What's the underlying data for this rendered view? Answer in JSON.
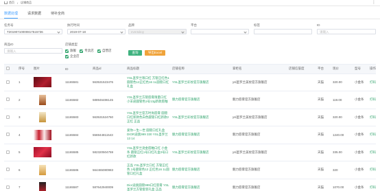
{
  "topbar": {
    "crumb1": "首页",
    "crumb2": "店铺商品",
    "right_icon": "more-icon"
  },
  "tabs": [
    {
      "label": "数据处理",
      "active": true
    },
    {
      "label": "请求数据",
      "active": false
    },
    {
      "label": "待补全商",
      "active": false
    }
  ],
  "filters": {
    "task_no": {
      "label": "任务号",
      "value": "T20190710000817515736"
    },
    "exec_time": {
      "label": "执行时间",
      "value": "2019-07-18"
    },
    "brand": {
      "label": "品牌",
      "value": "ever&boy"
    },
    "platform": {
      "label": "平台",
      "value": ""
    },
    "tag": {
      "label": "标签",
      "value": ""
    },
    "id": {
      "label": "ID",
      "placeholder": "请输入"
    },
    "product_id": {
      "label": "商品ID",
      "placeholder": "请输入"
    },
    "store_type": {
      "label": "店铺类型",
      "options": [
        "旗舰",
        "专卖店",
        "自营店",
        "企业店"
      ]
    },
    "search_btn": "查询",
    "export_btn": "导出Excel"
  },
  "table": {
    "headers": [
      "",
      "序号",
      "图片",
      "ID",
      "商品id",
      "商品标题",
      "店铺名称",
      "掌柜名",
      "店铺信誉度",
      "平台",
      "现价",
      "型号",
      "操作"
    ],
    "rows": [
      {
        "no": "1",
        "id": "11165581",
        "pid": "563531523476",
        "title": "YSL圣罗兰限口红 方管正红色1圆管色12正红色16 1L圆管口红礼盒",
        "store": "YSL圣罗兰彩妆官方旗舰店",
        "seller": "ysl圣罗兰美妆官方旗舰店",
        "credit": "",
        "platform": "天猫",
        "price": "320.00",
        "model": "小金条",
        "op": "打码"
      },
      {
        "no": "2",
        "id": "11165582",
        "pid": "588946486145",
        "title": "YSL圣罗兰方管唇膏限量口红 小羊皮圆管色1号13g新款唇釉",
        "store": "魅力唇膏官方旗舰店",
        "seller": "魅力唇膏官方旗舰店",
        "credit": "",
        "platform": "天猫",
        "price": "119.00",
        "model": "小金条",
        "op": "打码"
      },
      {
        "no": "3",
        "id": "11165583",
        "pid": "563531524750",
        "title": "YSL圣罗兰官方时尚唇膏 圆管口红新款色白色圆管口红新款2正红 正品",
        "store": "YSL圣罗兰彩妆官方旗舰店",
        "seller": "ysl圣罗兰美妆官方旗舰店",
        "credit": "",
        "platform": "天猫",
        "price": "320.00",
        "model": "小金条",
        "op": "打码"
      },
      {
        "no": "4",
        "id": "11165584",
        "pid": "556944811543",
        "title": "爱你一生一世 圆管口红礼盒 DIOR迪奥999 330 YSL圣罗兰13 14",
        "store": "魅力唇膏官方旗舰店",
        "seller": "魅力唇膏官方旗舰店",
        "credit": "",
        "platform": "天猫",
        "price": "1240.00",
        "model": "小金条",
        "op": "打码"
      },
      {
        "no": "5",
        "id": "11165585",
        "pid": "582320504759",
        "title": "YSL圣罗兰烫金唇釉口红 小金条 圆管正红1号口红礼盒2号口红新款",
        "store": "YSL圣罗兰彩妆官方旗舰店",
        "seller": "ysl圣罗兰美妆官方旗舰店",
        "credit": "",
        "platform": "天猫",
        "price": "335.00",
        "model": "小金条",
        "op": "打码"
      },
      {
        "no": "6",
        "id": "11165586",
        "pid": "564465080983",
        "title": "正品 YSL圣罗兰口红 方管正红色 1号圆管色12 正红色16 1L圆管口红礼盒",
        "store": "魅力唇膏官方旗舰店",
        "seller": "魅力唇膏官方旗舰店",
        "credit": "",
        "platform": "天猫",
        "price": "320",
        "model": "小金条",
        "op": "打码"
      },
      {
        "no": "7",
        "id": "11165587",
        "pid": "587642940009",
        "title": "Dior迪奥圆管999口红唇膏 YSL圣罗兰方管套装礼盒 正品",
        "store": "魅力唇膏官方旗舰店",
        "seller": "魅力唇膏官方旗舰店",
        "credit": "",
        "platform": "天猫",
        "price": "1070.00",
        "model": "小金条",
        "op": "打码"
      }
    ]
  }
}
